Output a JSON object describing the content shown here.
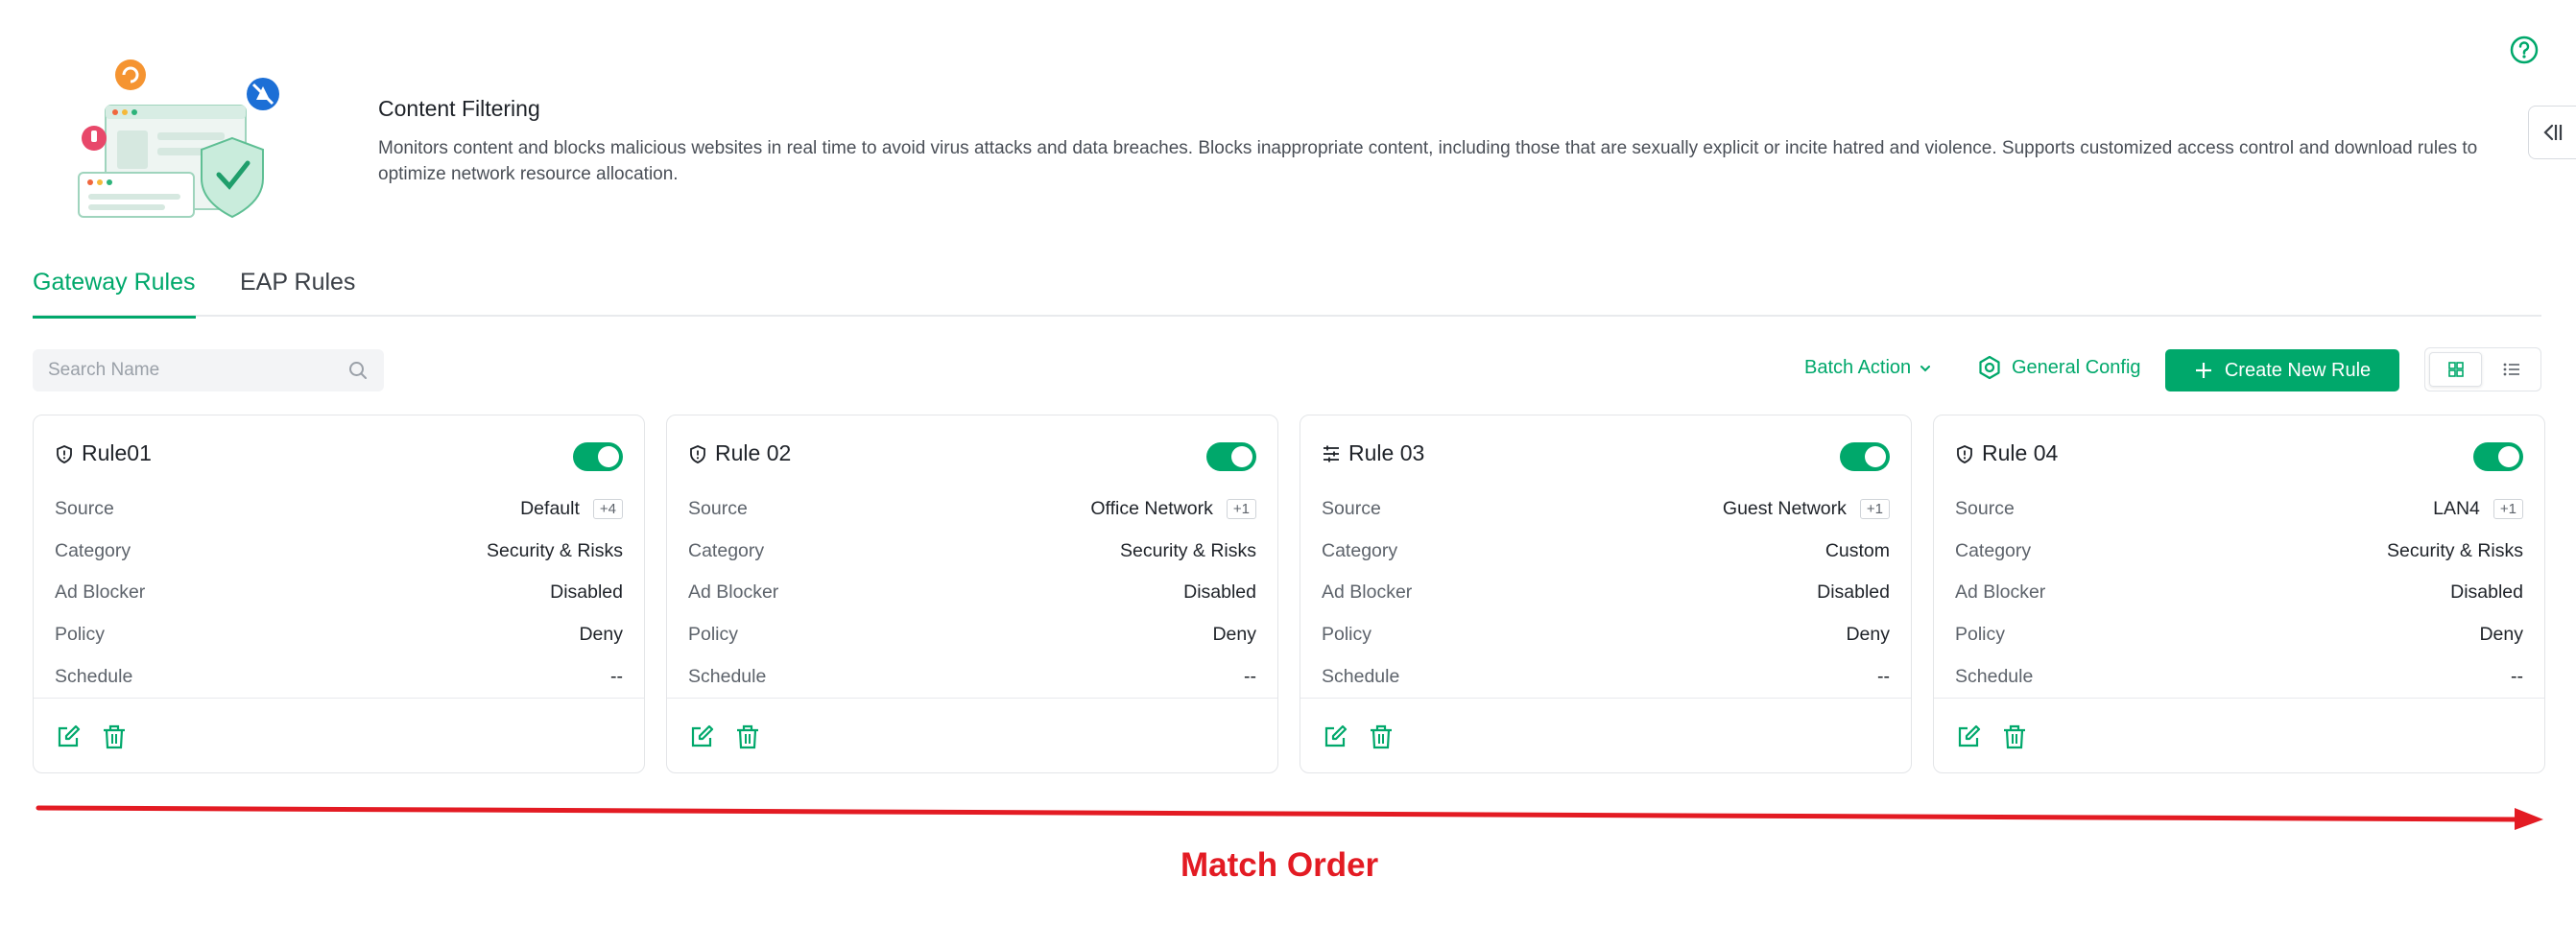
{
  "header": {
    "title": "Content Filtering",
    "description": "Monitors content and blocks malicious websites in real time to avoid virus attacks and data breaches. Blocks inappropriate content, including those that are sexually explicit or incite hatred and violence. Supports customized access control and download rules to optimize network resource allocation."
  },
  "tabs": [
    {
      "label": "Gateway Rules",
      "active": true
    },
    {
      "label": "EAP Rules",
      "active": false
    }
  ],
  "toolbar": {
    "search_placeholder": "Search Name",
    "batch_action": "Batch Action",
    "general_config": "General Config",
    "create_new_rule": "Create New Rule"
  },
  "field_labels": {
    "source": "Source",
    "category": "Category",
    "ad_blocker": "Ad Blocker",
    "policy": "Policy",
    "schedule": "Schedule"
  },
  "rules": [
    {
      "name": "Rule01",
      "icon": "shield-icon",
      "enabled": true,
      "source": "Default",
      "source_extra": "+4",
      "category": "Security & Risks",
      "ad_blocker": "Disabled",
      "policy": "Deny",
      "schedule": "--"
    },
    {
      "name": "Rule 02",
      "icon": "shield-icon",
      "enabled": true,
      "source": "Office Network",
      "source_extra": "+1",
      "category": "Security & Risks",
      "ad_blocker": "Disabled",
      "policy": "Deny",
      "schedule": "--"
    },
    {
      "name": "Rule 03",
      "icon": "sliders-icon",
      "enabled": true,
      "source": "Guest Network",
      "source_extra": "+1",
      "category": "Custom",
      "ad_blocker": "Disabled",
      "policy": "Deny",
      "schedule": "--"
    },
    {
      "name": "Rule 04",
      "icon": "shield-icon",
      "enabled": true,
      "source": "LAN4",
      "source_extra": "+1",
      "category": "Security & Risks",
      "ad_blocker": "Disabled",
      "policy": "Deny",
      "schedule": "--"
    }
  ],
  "annotation": {
    "label": "Match Order",
    "color": "#e31b23"
  },
  "colors": {
    "accent": "#00a86b"
  }
}
